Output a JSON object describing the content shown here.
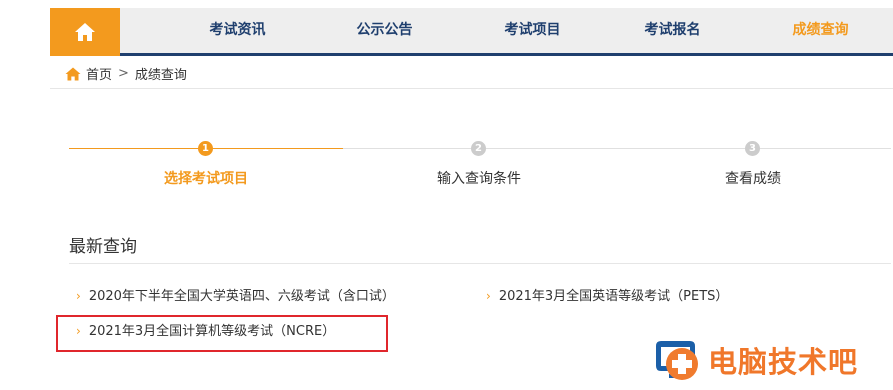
{
  "nav": {
    "items": [
      {
        "label": "考试资讯"
      },
      {
        "label": "公示公告"
      },
      {
        "label": "考试项目"
      },
      {
        "label": "考试报名"
      },
      {
        "label": "成绩查询"
      }
    ]
  },
  "breadcrumb": {
    "home": "首页",
    "separator": ">",
    "current": "成绩查询"
  },
  "steps": [
    {
      "number": "1",
      "label": "选择考试项目"
    },
    {
      "number": "2",
      "label": "输入查询条件"
    },
    {
      "number": "3",
      "label": "查看成绩"
    }
  ],
  "latest": {
    "title": "最新查询",
    "items": [
      {
        "label": "2020年下半年全国大学英语四、六级考试（含口试）"
      },
      {
        "label": "2021年3月全国英语等级考试（PETS）"
      },
      {
        "label": "2021年3月全国计算机等级考试（NCRE）"
      }
    ]
  },
  "watermark": {
    "text": "电脑技术吧"
  },
  "colors": {
    "accent": "#f39a1e",
    "navy": "#1f3f6e",
    "inactive_step": "#cccccc",
    "highlight": "#e0262c"
  }
}
